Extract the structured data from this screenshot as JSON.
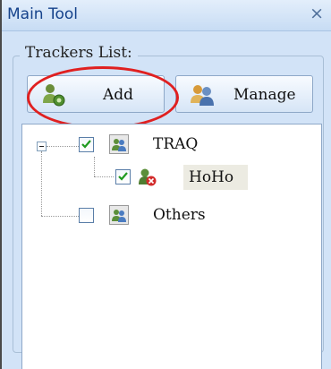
{
  "window": {
    "title": "Main Tool",
    "close_symbol": "×"
  },
  "trackers": {
    "group_label": "Trackers List:",
    "add_label": "Add",
    "manage_label": "Manage",
    "tree": [
      {
        "label": "TRAQ",
        "checked": true,
        "expanded": true,
        "children": [
          {
            "label": "HoHo",
            "checked": true,
            "selected": true
          }
        ]
      },
      {
        "label": "Others",
        "checked": false
      }
    ]
  },
  "colors": {
    "accent": "#15428b",
    "annotation": "#e02020",
    "panel": "#d2e3f7"
  }
}
